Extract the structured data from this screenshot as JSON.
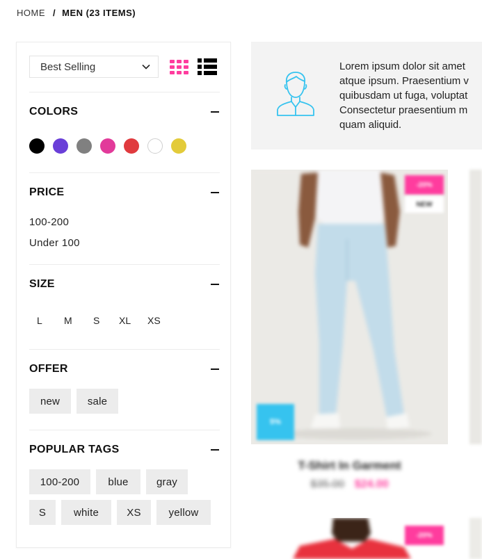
{
  "breadcrumb": {
    "home": "HOME",
    "separator": "/",
    "current": "MEN (23 ITEMS)"
  },
  "toolbar": {
    "sort_value": "Best Selling",
    "grid_icon": "grid-view-icon",
    "list_icon": "list-view-icon",
    "grid_color": "#ff3c9e"
  },
  "filters": {
    "colors": {
      "title": "COLORS",
      "swatches": [
        {
          "name": "black",
          "hex": "#000000"
        },
        {
          "name": "purple",
          "hex": "#6a3fd8"
        },
        {
          "name": "gray",
          "hex": "#808080"
        },
        {
          "name": "pink",
          "hex": "#e23a9a"
        },
        {
          "name": "red",
          "hex": "#e03a3e"
        },
        {
          "name": "white",
          "hex": "#ffffff"
        },
        {
          "name": "yellow",
          "hex": "#e3cb3a"
        }
      ]
    },
    "price": {
      "title": "PRICE",
      "options": [
        "100-200",
        "Under 100"
      ]
    },
    "size": {
      "title": "SIZE",
      "options": [
        "L",
        "M",
        "S",
        "XL",
        "XS"
      ]
    },
    "offer": {
      "title": "OFFER",
      "options": [
        "new",
        "sale"
      ]
    },
    "popular_tags": {
      "title": "POPULAR TAGS",
      "options": [
        "100-200",
        "blue",
        "gray",
        "S",
        "white",
        "XS",
        "yellow"
      ]
    }
  },
  "banner": {
    "icon": "customer-user-icon",
    "lines": [
      "Lorem ipsum dolor sit amet",
      "atque ipsum. Praesentium v",
      "quibusdam ut fuga, voluptat",
      "Consectetur praesentium m",
      "quam aliquid."
    ]
  },
  "products": [
    {
      "name": "T-Shirt In Garment",
      "old_price": "$35.00",
      "price": "$24.00",
      "badge_sale": "-20%",
      "badge_new": "NEW",
      "badge_off": "5%"
    },
    {
      "badge_sale": "-20%"
    }
  ],
  "colors": {
    "accent": "#ff3c9e",
    "off_badge": "#36c3ef",
    "banner_bg": "#f3f3f3",
    "tag_bg": "#ececec"
  }
}
